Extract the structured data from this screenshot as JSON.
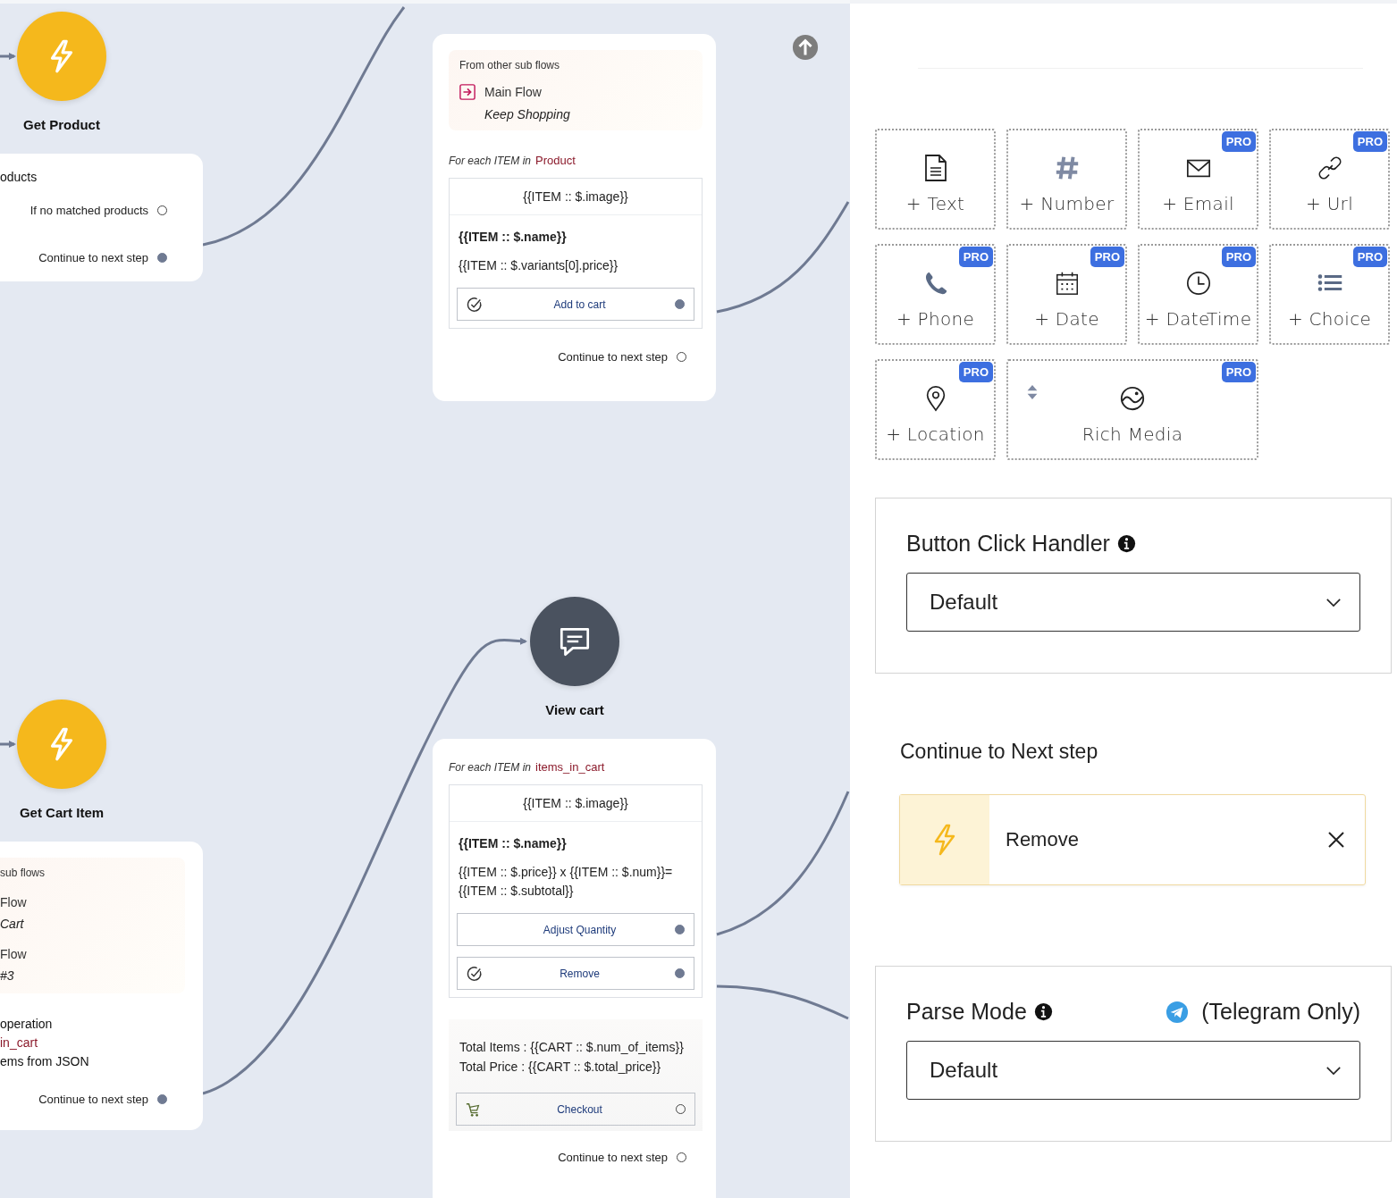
{
  "canvas": {
    "nodes": [
      {
        "kind": "trigger",
        "label": "Get Product"
      },
      {
        "kind": "trigger",
        "label": "Get Cart Item"
      },
      {
        "kind": "message",
        "label": "View cart"
      }
    ],
    "cards": [
      {
        "blocks": [
          {
            "kind": "text",
            "text": "oducts",
            "variable": false
          },
          {
            "kind": "port",
            "label": "If no matched products",
            "connected": false
          },
          {
            "kind": "port",
            "label": "Continue to next step",
            "connected": true
          }
        ]
      },
      {
        "blocks": [
          {
            "kind": "subflows",
            "title": "From other sub flows",
            "items": [
              {
                "flow": "Main Flow",
                "name": "Keep Shopping",
                "icon": true
              }
            ]
          },
          {
            "kind": "loop",
            "prefix": "For each ITEM in",
            "source": "Product",
            "image": "{{ITEM :: $.image}}",
            "name": "{{ITEM :: $.name}}",
            "price": "{{ITEM :: $.variants[0].price}}",
            "buttons": [
              {
                "label": "Add to cart",
                "kind": "check",
                "connected": true
              }
            ]
          },
          {
            "kind": "port",
            "label": "Continue to next step",
            "connected": false
          }
        ]
      },
      {
        "blocks": [
          {
            "kind": "loop",
            "prefix": "For each ITEM in",
            "source": "items_in_cart",
            "image": "{{ITEM :: $.image}}",
            "name": "{{ITEM :: $.name}}",
            "price": "{{ITEM :: $.price}} x {{ITEM :: $.num}}={{ITEM :: $.subtotal}}",
            "buttons": [
              {
                "label": "Adjust Quantity",
                "kind": "plain",
                "connected": true
              },
              {
                "label": "Remove",
                "kind": "check",
                "connected": true
              }
            ]
          },
          {
            "kind": "summary",
            "lines": [
              "Total Items : {{CART :: $.num_of_items}}",
              "Total Price : {{CART :: $.total_price}}"
            ],
            "button": {
              "label": "Checkout",
              "kind": "cart",
              "connected": false
            }
          },
          {
            "kind": "port",
            "label": "Continue to next step",
            "connected": false
          }
        ]
      },
      {
        "blocks": [
          {
            "kind": "subflows",
            "title": "sub flows",
            "items": [
              {
                "flow": "Flow",
                "name": "Cart",
                "icon": false
              },
              {
                "flow": "Flow",
                "name": "#3",
                "icon": false
              }
            ]
          },
          {
            "kind": "text",
            "text": "operation",
            "variable": false
          },
          {
            "kind": "text",
            "text": "in_cart",
            "variable": true
          },
          {
            "kind": "text",
            "text": "ems from JSON",
            "variable": false
          },
          {
            "kind": "port",
            "label": "Continue to next step",
            "connected": true
          }
        ]
      }
    ]
  },
  "right_panel": {
    "fields": [
      {
        "kind": "text",
        "label": "+ Text",
        "pro": false
      },
      {
        "kind": "number",
        "label": "+ Number",
        "pro": false
      },
      {
        "kind": "email",
        "label": "+ Email",
        "pro": true,
        "badge": "PRO"
      },
      {
        "kind": "url",
        "label": "+ Url",
        "pro": true,
        "badge": "PRO"
      },
      {
        "kind": "phone",
        "label": "+ Phone",
        "pro": true,
        "badge": "PRO"
      },
      {
        "kind": "date",
        "label": "+ Date",
        "pro": true,
        "badge": "PRO"
      },
      {
        "kind": "datetime",
        "label": "+ DateTime",
        "pro": true,
        "badge": "PRO"
      },
      {
        "kind": "choice",
        "label": "+ Choice",
        "pro": true,
        "badge": "PRO"
      },
      {
        "kind": "location",
        "label": "+ Location",
        "pro": true,
        "badge": "PRO"
      },
      {
        "kind": "media",
        "label": "Rich Media",
        "pro": true,
        "badge": "PRO"
      }
    ],
    "button_click_handler": {
      "label": "Button Click Handler",
      "value": "Default"
    },
    "continue_to_next_step": {
      "heading": "Continue to Next step",
      "item": {
        "label": "Remove"
      }
    },
    "parse_mode": {
      "label": "Parse Mode",
      "note": "(Telegram Only)",
      "value": "Default"
    }
  }
}
